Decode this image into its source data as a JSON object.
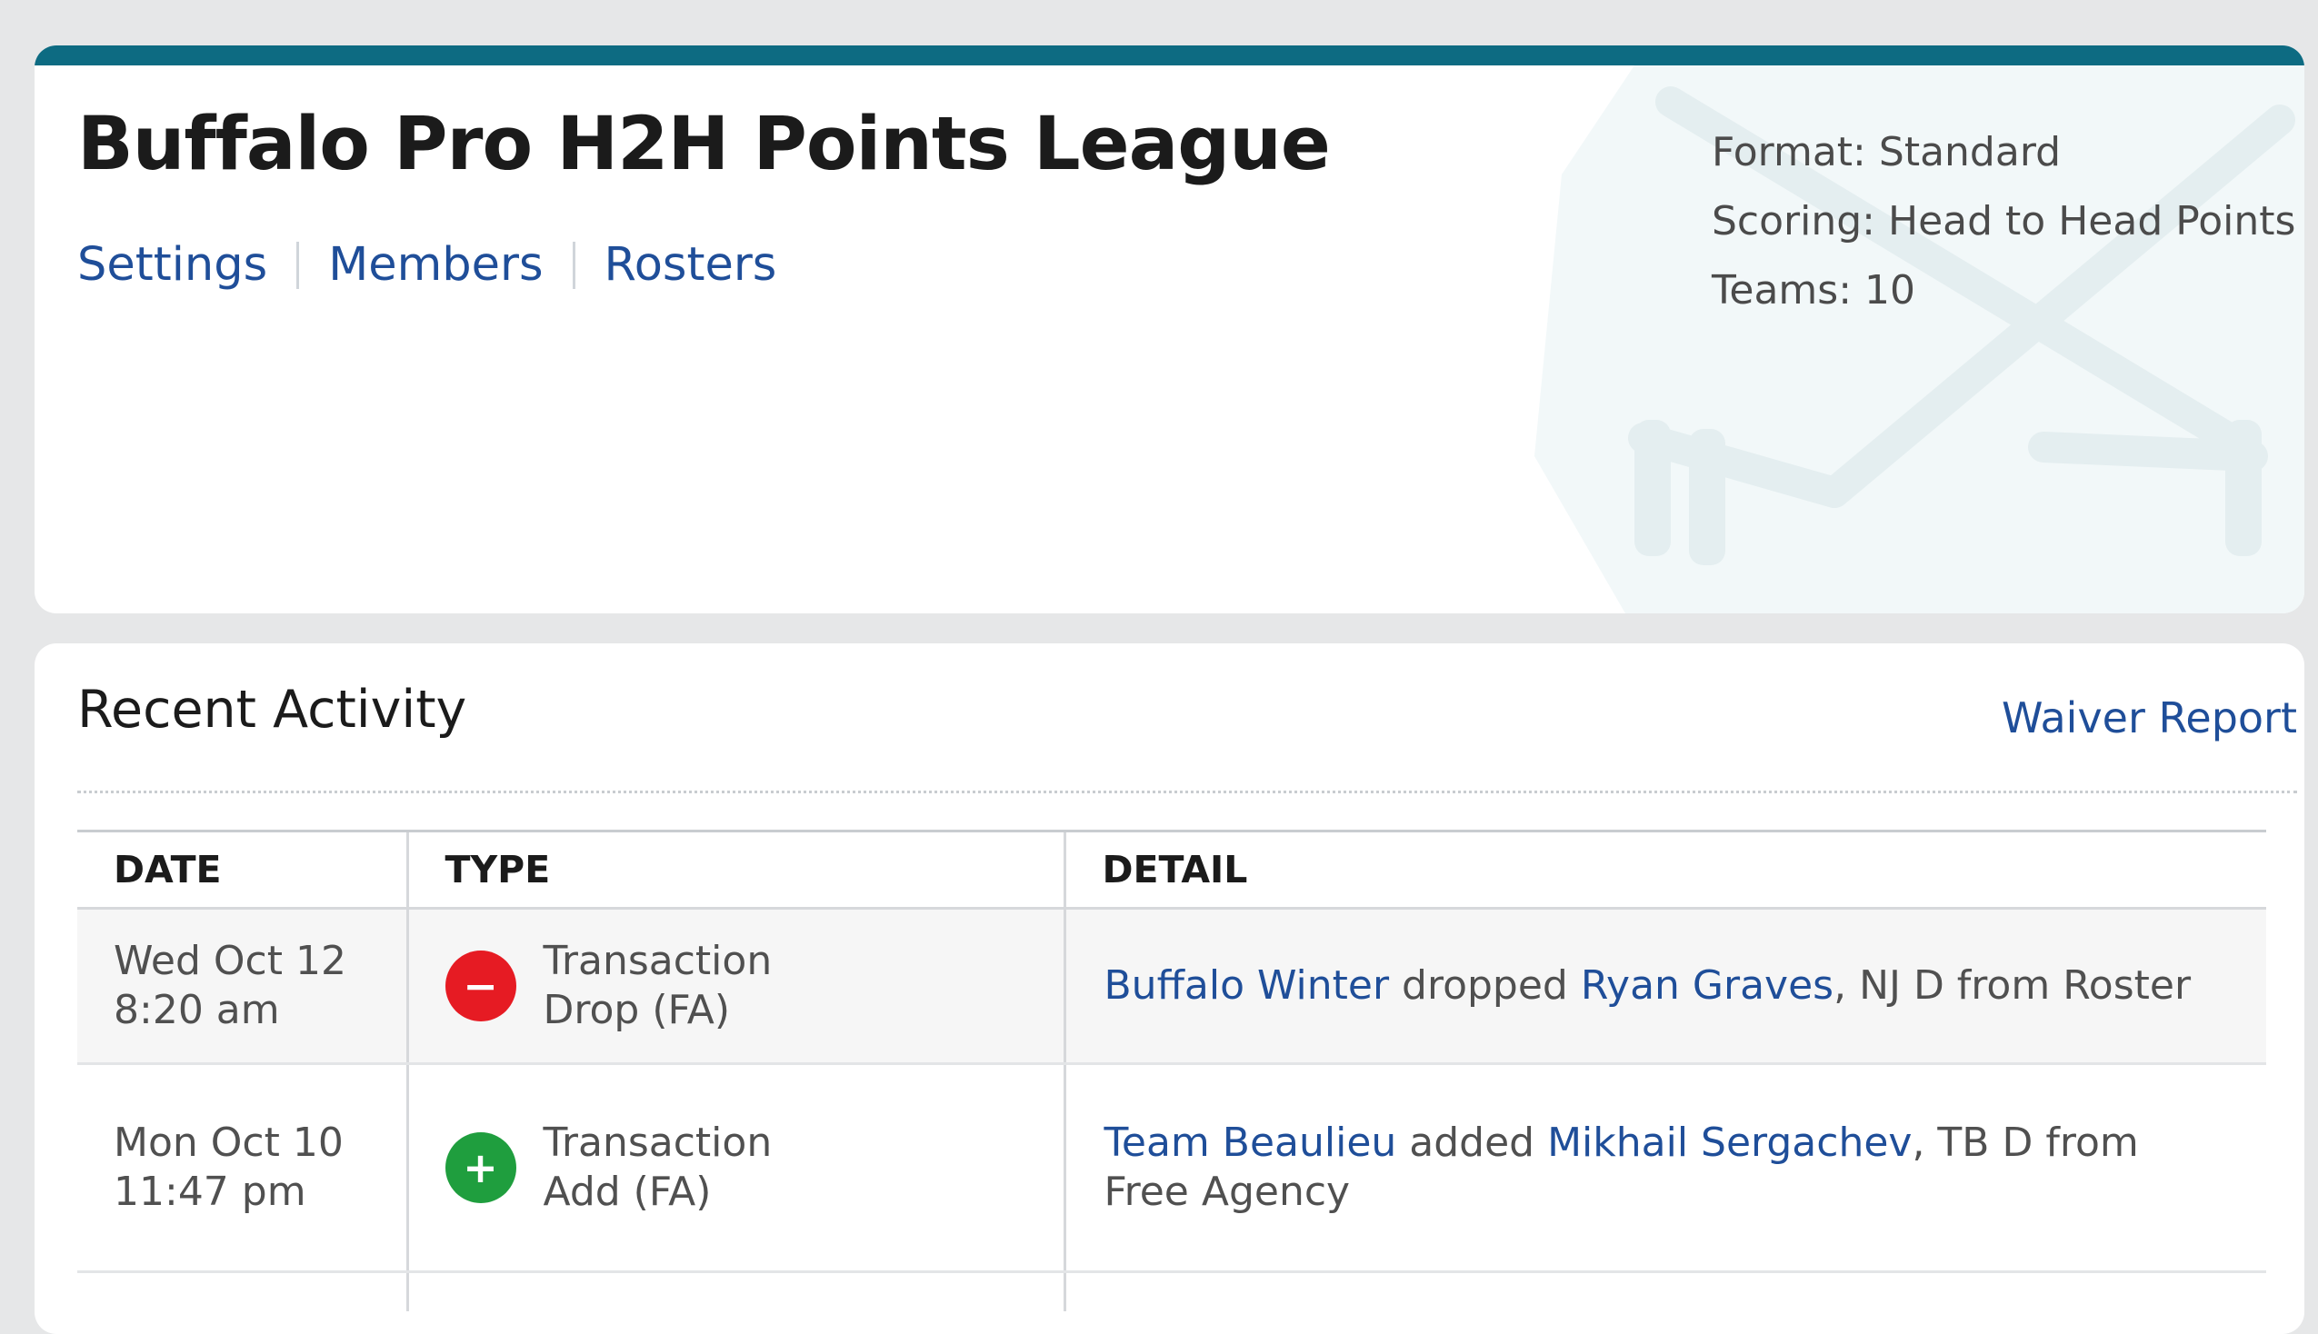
{
  "league": {
    "title": "Buffalo Pro H2H Points League",
    "nav": [
      "Settings",
      "Members",
      "Rosters"
    ],
    "meta": {
      "format_label": "Format:",
      "format_value": "Standard",
      "scoring_label": "Scoring:",
      "scoring_value": "Head to Head Points",
      "teams_label": "Teams:",
      "teams_value": "10"
    },
    "accent_color": "#0d6b82",
    "watermark_icon": "crossed-hockey-sticks-icon"
  },
  "activity": {
    "title": "Recent Activity",
    "waiver_link": "Waiver Report",
    "columns": [
      "DATE",
      "TYPE",
      "DETAIL"
    ],
    "rows": [
      {
        "date_line1": "Wed Oct 12",
        "date_line2": "8:20 am",
        "icon": "minus-icon",
        "icon_glyph": "−",
        "icon_color": "#e61b23",
        "type_line1": "Transaction",
        "type_line2": "Drop (FA)",
        "team": "Buffalo Winter",
        "verb": " dropped ",
        "player": "Ryan Graves",
        "rest": ", NJ D from Roster"
      },
      {
        "date_line1": "Mon Oct 10",
        "date_line2": "11:47 pm",
        "icon": "plus-icon",
        "icon_glyph": "+",
        "icon_color": "#1f9e3e",
        "type_line1": "Transaction",
        "type_line2": "Add (FA)",
        "team": "Team Beaulieu",
        "verb": " added ",
        "player": "Mikhail Sergachev",
        "rest": ", TB D from Free Agency"
      }
    ]
  }
}
